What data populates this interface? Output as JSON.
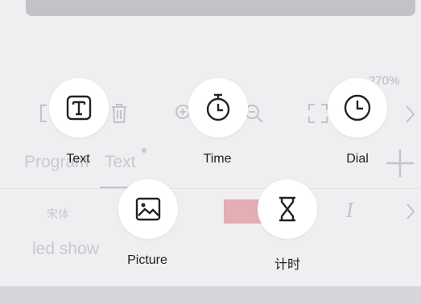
{
  "background_editor": {
    "zoom": "270%",
    "tabs": [
      "Program",
      "Text"
    ],
    "font_name": "宋体",
    "text_content": "led show",
    "color_swatch": "#e3aeb4"
  },
  "add_menu": {
    "items": [
      {
        "label": "Text",
        "icon": "text-box-icon"
      },
      {
        "label": "Time",
        "icon": "stopwatch-icon"
      },
      {
        "label": "Dial",
        "icon": "clock-icon"
      },
      {
        "label": "Picture",
        "icon": "image-icon"
      },
      {
        "label": "计时",
        "icon": "hourglass-icon"
      }
    ]
  }
}
